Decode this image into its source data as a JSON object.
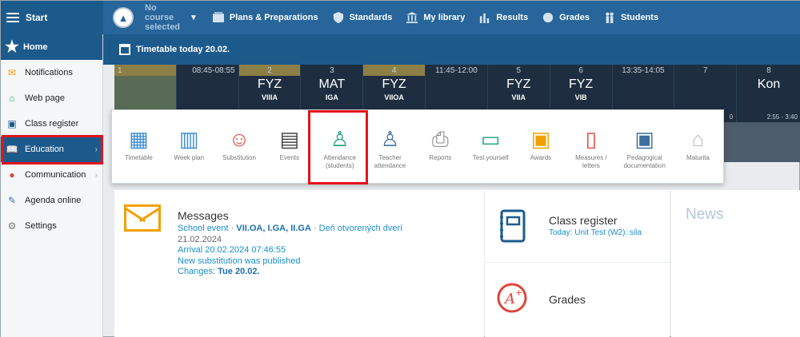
{
  "topbar": {
    "start_label": "Start",
    "course_label": "No course selected",
    "nav": [
      {
        "label": "Plans & Preparations",
        "icon": "books-icon"
      },
      {
        "label": "Standards",
        "icon": "shield-icon"
      },
      {
        "label": "My library",
        "icon": "library-icon"
      },
      {
        "label": "Results",
        "icon": "bar-chart-icon"
      },
      {
        "label": "Grades",
        "icon": "grade-icon"
      },
      {
        "label": "Students",
        "icon": "students-icon"
      }
    ]
  },
  "sidebar": {
    "home_label": "Home",
    "items": [
      {
        "label": "Notifications",
        "icon": "envelope-icon"
      },
      {
        "label": "Web page",
        "icon": "home-icon"
      },
      {
        "label": "Class register",
        "icon": "register-icon"
      },
      {
        "label": "Education",
        "icon": "book-icon"
      },
      {
        "label": "Communication",
        "icon": "chat-icon"
      },
      {
        "label": "Agenda online",
        "icon": "pen-icon"
      },
      {
        "label": "Settings",
        "icon": "gear-icon"
      }
    ]
  },
  "timetable": {
    "title": "Timetable today 20.02.",
    "cells": [
      {
        "num": "1",
        "time": "08:45-08:55",
        "subject": "",
        "cls": ""
      },
      {
        "num": "",
        "time": "",
        "subject": "",
        "cls": ""
      },
      {
        "num": "2",
        "time": "",
        "subject": "FYZ",
        "cls": "VIIIA"
      },
      {
        "num": "3",
        "time": "",
        "subject": "MAT",
        "cls": "IGA"
      },
      {
        "num": "4",
        "time": "",
        "subject": "FYZ",
        "cls": "VIIOA"
      },
      {
        "num": "",
        "time": "11:45-12:00",
        "subject": "",
        "cls": ""
      },
      {
        "num": "5",
        "time": "",
        "subject": "FYZ",
        "cls": "VIIA"
      },
      {
        "num": "6",
        "time": "",
        "subject": "FYZ",
        "cls": "VIB"
      },
      {
        "num": "",
        "time": "13:35-14:05",
        "subject": "",
        "cls": ""
      },
      {
        "num": "7",
        "time": "",
        "subject": "",
        "cls": ""
      },
      {
        "num": "8",
        "time": "",
        "subject": "Kon",
        "cls": ""
      }
    ],
    "end_time": "2:55 - 3:40",
    "prev_time_fragment": "0"
  },
  "education_menu": [
    {
      "label": "Timetable",
      "icon": "timetable-icon",
      "color": "#3f8ed0"
    },
    {
      "label": "Week plan",
      "icon": "week-plan-icon",
      "color": "#3f8ed0"
    },
    {
      "label": "Substitution",
      "icon": "substitution-icon",
      "color": "#e0453a"
    },
    {
      "label": "Events",
      "icon": "events-icon",
      "color": "#444444"
    },
    {
      "label": "Attendance (students)",
      "icon": "attendance-icon",
      "color": "#1aa37a"
    },
    {
      "label": "Teacher attendance",
      "icon": "teacher-attendance-icon",
      "color": "#3f6fa0"
    },
    {
      "label": "Reports",
      "icon": "printer-icon",
      "color": "#888888"
    },
    {
      "label": "Test yourself",
      "icon": "test-icon",
      "color": "#1aa37a"
    },
    {
      "label": "Awards",
      "icon": "award-icon",
      "color": "#f0a000"
    },
    {
      "label": "Measures / letters",
      "icon": "letter-icon",
      "color": "#e0453a"
    },
    {
      "label": "Pedagogical documentation",
      "icon": "documentation-icon",
      "color": "#3f6fa0"
    },
    {
      "label": "Maturita",
      "icon": "graduation-cap-icon",
      "color": "#aaaaaa"
    }
  ],
  "messages": {
    "title": "Messages",
    "l1_prefix": "School event · ",
    "l1_bold": "VII.OA, I.GA, II.GA",
    "l1_suffix": " · Deň otvorených dverí",
    "l2": "21.02.2024",
    "l3": "Arrival 20.02.2024 07:46:55",
    "l4": "New substitution was published",
    "l5_prefix": "Changes: ",
    "l5_bold": "Tue 20.02."
  },
  "class_register": {
    "title": "Class register",
    "subtitle": "Today: Unit Test (W2): sila"
  },
  "grades": {
    "title": "Grades"
  },
  "news": {
    "title": "News"
  }
}
